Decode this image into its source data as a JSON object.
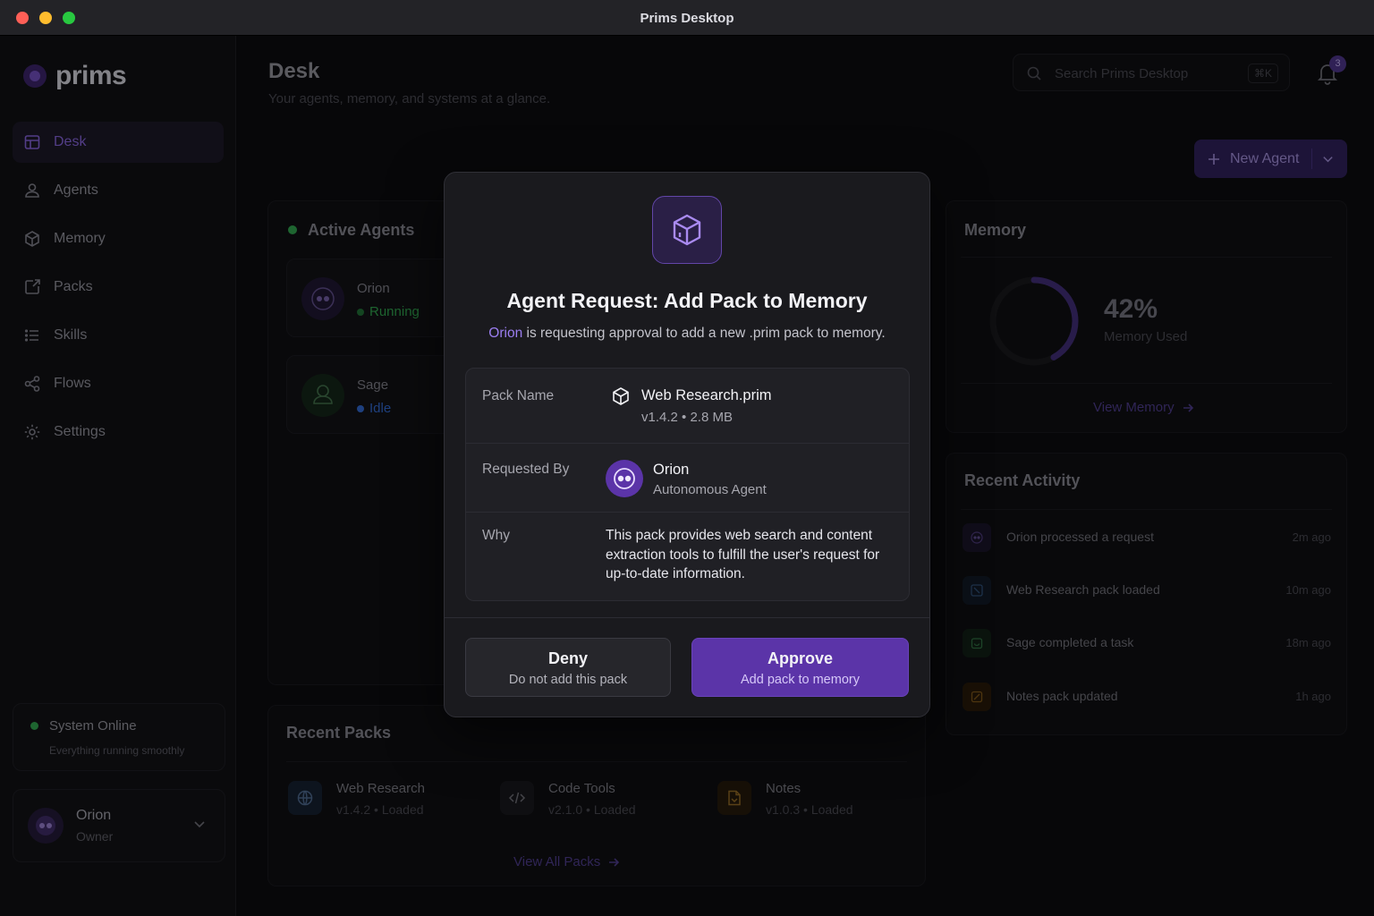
{
  "window": {
    "title": "Prims Desktop"
  },
  "sidebar": {
    "brand": "prims",
    "items": [
      {
        "label": "Desk",
        "icon": "desk-icon",
        "active": true
      },
      {
        "label": "Agents",
        "icon": "user-icon"
      },
      {
        "label": "Memory",
        "icon": "cube-icon"
      },
      {
        "label": "Packs",
        "icon": "package-icon"
      },
      {
        "label": "Skills",
        "icon": "list-icon"
      },
      {
        "label": "Flows",
        "icon": "share-icon"
      },
      {
        "label": "Settings",
        "icon": "gear-icon"
      }
    ],
    "status": {
      "title": "System Online",
      "subtitle": "Everything running smoothly"
    },
    "user": {
      "name": "Orion",
      "role": "Owner"
    }
  },
  "header": {
    "title": "Desk",
    "subtitle": "Your agents, memory, and systems at a glance.",
    "search_placeholder": "Search Prims Desktop",
    "search_shortcut": "⌘K",
    "notification_count": "3",
    "new_agent_label": "New Agent"
  },
  "active_agents": {
    "title": "Active Agents",
    "agents": [
      {
        "name": "Orion",
        "status": "Running",
        "status_color": "#2e9b4b"
      },
      {
        "name": "Sage",
        "status": "Idle",
        "status_color": "#2f63c4"
      }
    ]
  },
  "memory": {
    "title": "Memory",
    "value": "42%",
    "percent": 42,
    "label": "Memory Used",
    "link": "View Memory"
  },
  "recent_activity": {
    "title": "Recent Activity",
    "items": [
      {
        "text": "Orion processed a request",
        "time": "2m ago",
        "color": "#3b2a66"
      },
      {
        "text": "Web Research pack loaded",
        "time": "10m ago",
        "color": "#1d3557"
      },
      {
        "text": "Sage completed a task",
        "time": "18m ago",
        "color": "#1e4a2e"
      },
      {
        "text": "Notes pack updated",
        "time": "1h ago",
        "color": "#5a3b12"
      }
    ]
  },
  "recent_packs": {
    "title": "Recent Packs",
    "packs": [
      {
        "name": "Web Research",
        "version": "v1.4.2",
        "status": "Loaded"
      },
      {
        "name": "Code Tools",
        "version": "v2.1.0",
        "status": "Loaded"
      },
      {
        "name": "Notes",
        "version": "v1.0.3",
        "status": "Loaded"
      }
    ],
    "link": "View All Packs"
  },
  "modal": {
    "title": "Agent Request: Add Pack to Memory",
    "subtitle_agent": "Orion",
    "subtitle_text": " is requesting approval to add a new .prim pack to memory.",
    "pack_label": "Pack Name",
    "pack_name": "Web Research.prim",
    "pack_meta": "v1.4.2  •  2.8 MB",
    "requested_label": "Requested By",
    "requester_name": "Orion",
    "requester_role": "Autonomous Agent",
    "why_label": "Why",
    "why_text": "This pack provides web search and content extraction tools to fulfill the user's request for up-to-date information.",
    "deny_title": "Deny",
    "deny_sub": "Do not add this pack",
    "approve_title": "Approve",
    "approve_sub": "Add pack to memory"
  }
}
